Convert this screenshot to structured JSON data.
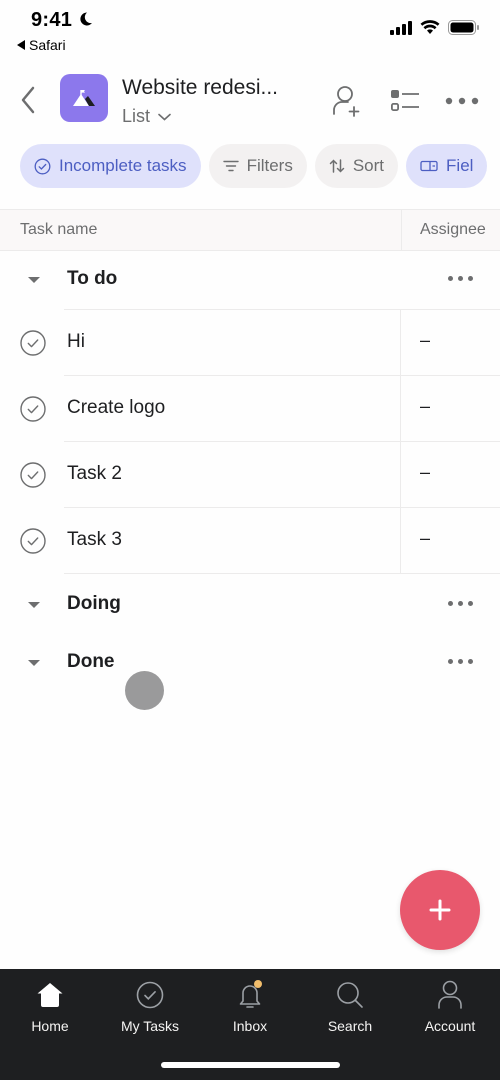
{
  "status_bar": {
    "time": "9:41",
    "back_app": "Safari"
  },
  "header": {
    "project_title": "Website redesi...",
    "view_label": "List"
  },
  "chips": [
    {
      "label": "Incomplete tasks",
      "icon": "check-circle-icon",
      "active": true
    },
    {
      "label": "Filters",
      "icon": "filter-icon",
      "active": false
    },
    {
      "label": "Sort",
      "icon": "sort-icon",
      "active": false
    },
    {
      "label": "Fiel",
      "icon": "fields-icon",
      "active": true
    }
  ],
  "table": {
    "columns": [
      "Task name",
      "Assignee"
    ]
  },
  "sections": [
    {
      "title": "To do",
      "tasks": [
        {
          "name": "Hi",
          "assignee": "–"
        },
        {
          "name": "Create logo",
          "assignee": "–"
        },
        {
          "name": "Task 2",
          "assignee": "–"
        },
        {
          "name": "Task 3",
          "assignee": "–"
        }
      ]
    },
    {
      "title": "Doing",
      "tasks": []
    },
    {
      "title": "Done",
      "tasks": []
    }
  ],
  "tab_bar": {
    "tabs": [
      {
        "label": "Home",
        "icon": "home-icon",
        "active": true
      },
      {
        "label": "My Tasks",
        "icon": "check-circle-icon",
        "active": false
      },
      {
        "label": "Inbox",
        "icon": "bell-icon",
        "active": false,
        "badge": true
      },
      {
        "label": "Search",
        "icon": "search-icon",
        "active": false
      },
      {
        "label": "Account",
        "icon": "account-icon",
        "active": false
      }
    ]
  },
  "colors": {
    "project_icon": "#8c78ec",
    "chip_active_bg": "#dfe1fb",
    "chip_active_text": "#4c5ec2",
    "fab": "#e8586d",
    "tab_bar_bg": "#1e1f21",
    "inbox_badge": "#f1bd6c"
  }
}
